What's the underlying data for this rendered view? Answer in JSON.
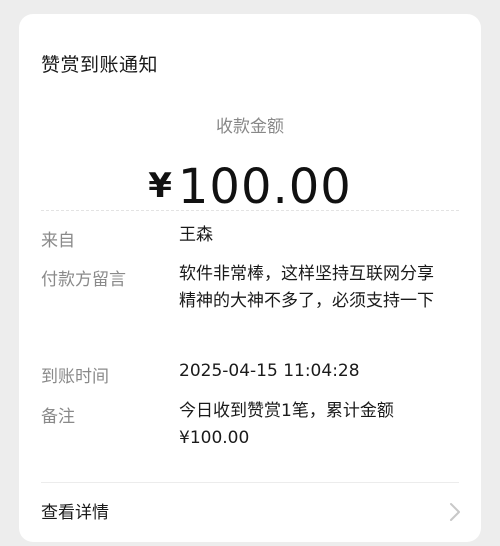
{
  "card": {
    "title": "赞赏到账通知",
    "amount_label": "收款金额",
    "currency_symbol": "¥",
    "amount_value": "100.00"
  },
  "rows": {
    "from": {
      "label": "来自",
      "value": "王森"
    },
    "message": {
      "label": "付款方留言",
      "value": "软件非常棒，这样坚持互联网分享精神的大神不多了，必须支持一下"
    },
    "time": {
      "label": "到账时间",
      "value": "2025-04-15 11:04:28"
    },
    "note": {
      "label": "备注",
      "line1": "今日收到赞赏1笔，累计金额",
      "line2": "¥100.00"
    }
  },
  "footer": {
    "detail_label": "查看详情",
    "chevron_icon": "chevron-right-icon"
  },
  "colors": {
    "background": "#ededed",
    "card": "#ffffff",
    "primary_text": "#1a1a1a",
    "secondary_text": "#8a8a8a"
  }
}
